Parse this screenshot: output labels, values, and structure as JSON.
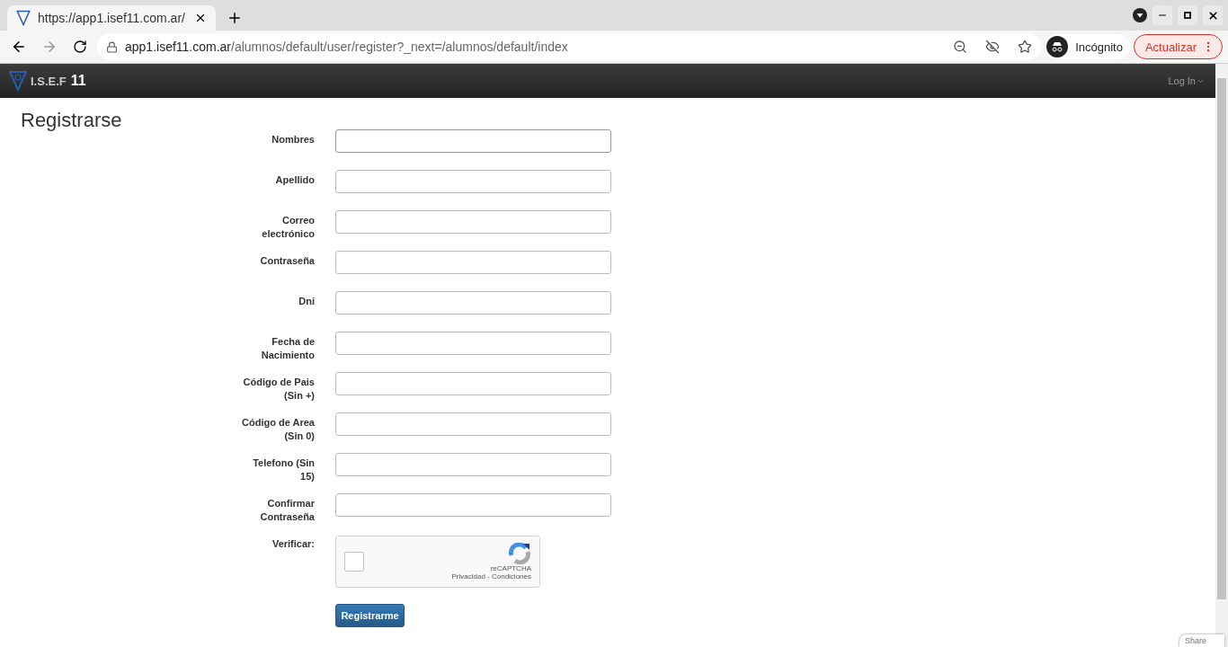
{
  "browser": {
    "tab": {
      "title": "https://app1.isef11.com.ar/",
      "selected": true
    },
    "address": {
      "host": "app1.isef11.com.ar",
      "path": "/alumnos/default/user/register?_next=/alumnos/default/index"
    },
    "profile": "Incógnito",
    "update_button": "Actualizar"
  },
  "navbar": {
    "brand": "I.S.E.F",
    "brand_number": "11",
    "login": "Log In"
  },
  "page": {
    "title": "Registrarse",
    "fields": [
      {
        "label": "Nombres",
        "focused": true
      },
      {
        "label": "Apellido",
        "focused": false
      },
      {
        "label": "Correo electrónico",
        "focused": false
      },
      {
        "label": "Contraseña",
        "focused": false
      },
      {
        "label": "Dni",
        "focused": false
      },
      {
        "label": "Fecha de Nacimiento",
        "focused": false
      },
      {
        "label": "Código de Pais (Sin +)",
        "focused": false
      },
      {
        "label": "Código de Area (Sin 0)",
        "focused": false
      },
      {
        "label": "Telefono (Sin 15)",
        "focused": false
      },
      {
        "label": "Confirmar Contraseña",
        "focused": false
      }
    ],
    "captcha": {
      "label": "Verificar:",
      "checked": false,
      "brand": "reCAPTCHA",
      "links": "Privacidad - Condiciones"
    },
    "submit": "Registrarme"
  },
  "share": "Share"
}
